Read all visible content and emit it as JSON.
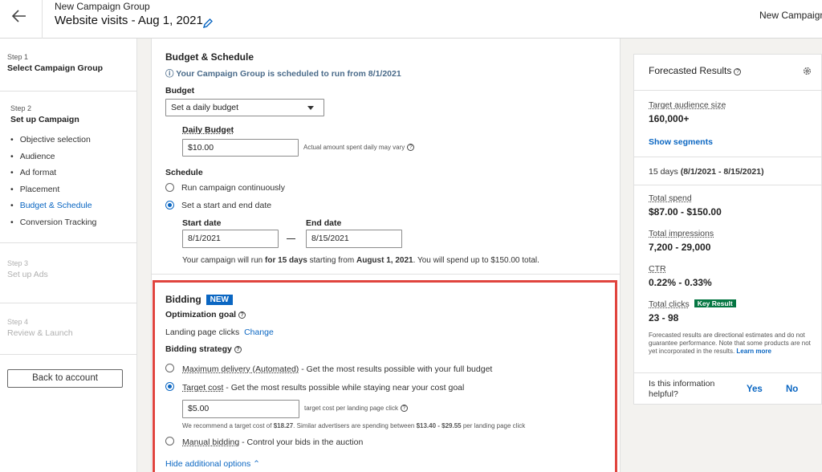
{
  "header": {
    "subtitle": "New Campaign Group",
    "title": "Website visits - Aug 1, 2021",
    "right_text": "New Campaign"
  },
  "sidebar": {
    "step1": {
      "num": "Step 1",
      "name": "Select Campaign Group"
    },
    "step2": {
      "num": "Step 2",
      "name": "Set up Campaign"
    },
    "sub_items": [
      "Objective selection",
      "Audience",
      "Ad format",
      "Placement",
      "Budget & Schedule",
      "Conversion Tracking"
    ],
    "active_sub_item": "Budget & Schedule",
    "step3": {
      "num": "Step 3",
      "name": "Set up Ads"
    },
    "step4": {
      "num": "Step 4",
      "name": "Review & Launch"
    },
    "back_button": "Back to account"
  },
  "budget": {
    "title": "Budget & Schedule",
    "info": "Your Campaign Group is scheduled to run from 8/1/2021",
    "budget_label": "Budget",
    "budget_select": "Set a daily budget",
    "daily_label": "Daily Budget",
    "daily_value": "$10.00",
    "daily_hint": "Actual amount spent daily may vary",
    "schedule_label": "Schedule",
    "opt_continuous": "Run campaign continuously",
    "opt_dates": "Set a start and end date",
    "start_label": "Start date",
    "start_value": "8/1/2021",
    "end_label": "End date",
    "end_value": "8/15/2021",
    "summary_pre": "Your campaign will run ",
    "summary_days": "for 15 days",
    "summary_mid": " starting from ",
    "summary_date": "August 1, 2021",
    "summary_post": ". You will spend up to $150.00 total."
  },
  "bidding": {
    "title": "Bidding",
    "badge": "NEW",
    "opt_goal_label": "Optimization goal",
    "opt_goal_value": "Landing page clicks",
    "change_link": "Change",
    "strategy_label": "Bidding strategy",
    "max_delivery": "Maximum delivery (Automated)",
    "max_delivery_desc": " - Get the most results possible with your full budget",
    "target_cost": "Target cost",
    "target_cost_desc": " - Get the most results possible while staying near your cost goal",
    "target_value": "$5.00",
    "target_hint": "target cost per landing page click",
    "recommend_pre": "We recommend a target cost of ",
    "recommend_val": "$18.27",
    "recommend_mid": ". Similar advertisers are spending between ",
    "recommend_range": "$13.40 - $29.55",
    "recommend_post": " per landing page click",
    "manual": "Manual bidding",
    "manual_desc": " - Control your bids in the auction",
    "hide_link": "Hide additional options"
  },
  "forecast": {
    "title": "Forecasted Results",
    "audience_label": "Target audience size",
    "audience_value": "160,000+",
    "show_segments": "Show segments",
    "days_pre": "15 days ",
    "days_range": "(8/1/2021 - 8/15/2021)",
    "spend_label": "Total spend",
    "spend_value": "$87.00 - $150.00",
    "impr_label": "Total impressions",
    "impr_value": "7,200 - 29,000",
    "ctr_label": "CTR",
    "ctr_value": "0.22% - 0.33%",
    "clicks_label": "Total clicks",
    "key_badge": "Key Result",
    "clicks_value": "23 - 98",
    "note": "Forecasted results are directional estimates and do not guarantee performance. Note that some products are not yet incorporated in the results.",
    "learn_more": "Learn more",
    "helpful_q": "Is this information helpful?",
    "yes": "Yes",
    "no": "No"
  },
  "colors": {
    "accent": "#0a66c2",
    "highlight": "#e0443e",
    "key_result": "#057642"
  }
}
